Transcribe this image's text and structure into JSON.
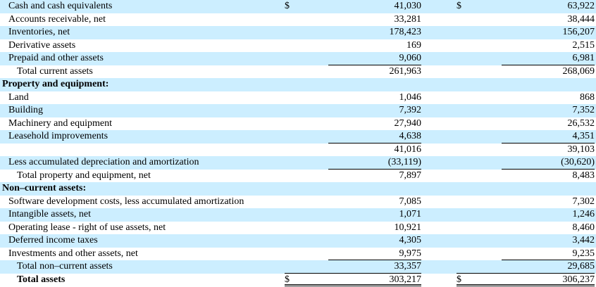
{
  "rows": [
    {
      "label": "Cash and cash equivalents",
      "c1": "$",
      "v1": "41,030",
      "c2": "$",
      "v2": "63,922"
    },
    {
      "label": "Accounts receivable, net",
      "v1": "33,281",
      "v2": "38,444"
    },
    {
      "label": "Inventories, net",
      "v1": "178,423",
      "v2": "156,207"
    },
    {
      "label": "Derivative assets",
      "v1": "169",
      "v2": "2,515"
    },
    {
      "label": "Prepaid and other assets",
      "v1": "9,060",
      "v2": "6,981"
    },
    {
      "label": "Total current assets",
      "v1": "261,963",
      "v2": "268,069"
    },
    {
      "label": "Property and equipment:"
    },
    {
      "label": "Land",
      "v1": "1,046",
      "v2": "868"
    },
    {
      "label": "Building",
      "v1": "7,392",
      "v2": "7,352"
    },
    {
      "label": "Machinery and equipment",
      "v1": "27,940",
      "v2": "26,532"
    },
    {
      "label": "Leasehold improvements",
      "v1": "4,638",
      "v2": "4,351"
    },
    {
      "label": "",
      "v1": "41,016",
      "v2": "39,103"
    },
    {
      "label": "Less accumulated depreciation and amortization",
      "v1": "(33,119)",
      "v2": "(30,620)"
    },
    {
      "label": "Total property and equipment, net",
      "v1": "7,897",
      "v2": "8,483"
    },
    {
      "label": "Non–current assets:"
    },
    {
      "label": "Software development costs, less accumulated amortization",
      "v1": "7,085",
      "v2": "7,302"
    },
    {
      "label": "Intangible assets, net",
      "v1": "1,071",
      "v2": "1,246"
    },
    {
      "label": "Operating lease - right of use assets, net",
      "v1": "10,921",
      "v2": "8,460"
    },
    {
      "label": "Deferred income taxes",
      "v1": "4,305",
      "v2": "3,442"
    },
    {
      "label": "Investments and other assets, net",
      "v1": "9,975",
      "v2": "9,235"
    },
    {
      "label": "Total non–current assets",
      "v1": "33,357",
      "v2": "29,685"
    },
    {
      "label": "Total assets",
      "c1": "$",
      "v1": "303,217",
      "c2": "$",
      "v2": "306,237"
    }
  ]
}
